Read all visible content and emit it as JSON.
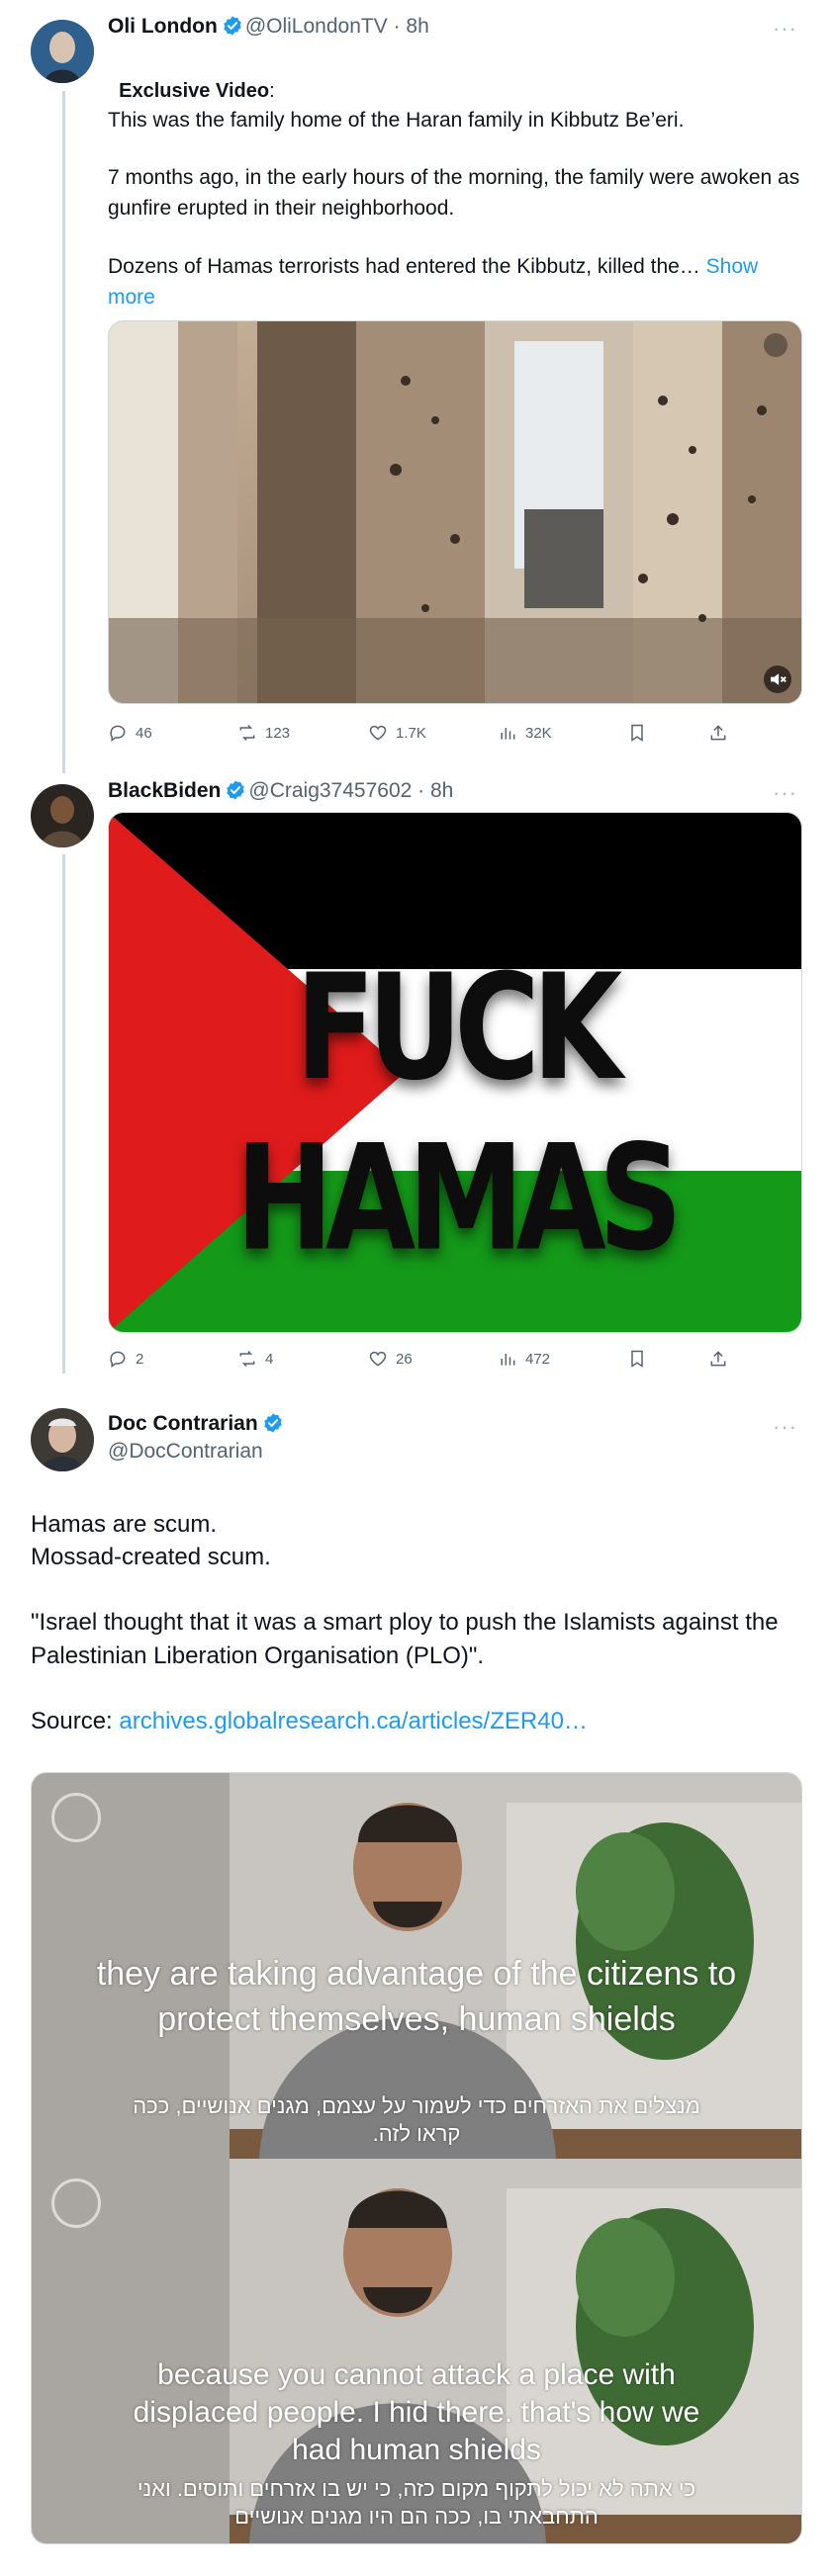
{
  "tweets": [
    {
      "name": "Oli London",
      "handle": "@OliLondonTV",
      "time": "8h",
      "lead": "Exclusive Video",
      "lead_suffix": ":",
      "para1": "This was the family home of the Haran family in Kibbutz Be’eri.",
      "para2": "7 months ago, in the early hours of the morning, the family were awoken as gunfire erupted in their neighborhood.",
      "para3": "Dozens of Hamas terrorists had entered the Kibbutz, killed the…",
      "show_more": "Show more",
      "stats": {
        "replies": "46",
        "reposts": "123",
        "likes": "1.7K",
        "views": "32K"
      }
    },
    {
      "name": "BlackBiden",
      "handle": "@Craig37457602",
      "time": "8h",
      "image_text": "FUCK HAMAS",
      "stats": {
        "replies": "2",
        "reposts": "4",
        "likes": "26",
        "views": "472"
      }
    },
    {
      "name": "Doc Contrarian",
      "handle": "@DocContrarian",
      "line1": "Hamas are scum.",
      "line2": "Mossad-created scum.",
      "line3": "\"Israel thought that it was a smart ploy to push the Islamists against the Palestinian Liberation Organisation (PLO)\".",
      "source_label": "Source: ",
      "source_link": "archives.globalresearch.ca/articles/ZER40…",
      "sub1_en": "they are taking advantage of the citizens to protect themselves, human shields",
      "sub1_he": "מנצלים את האזרחים כדי לשמור על עצמם, מגנים אנושיים, ככה קראו לזה.",
      "sub2_en": "because you cannot attack a place with displaced people. I hid there. that's how we had human shields",
      "sub2_he": "כי אתה לא יכול לתקוף מקום כזה, כי יש בו אזרחים ותוסים. ואני התחבאתי בו, ככה הם היו מגנים אנושיים"
    }
  ],
  "ui": {
    "separator": " · ",
    "more": "···"
  },
  "colors": {
    "link": "#1d9bf0",
    "secondary": "#536471",
    "verified": "#1d9bf0",
    "thread_line": "#cfd9de"
  }
}
